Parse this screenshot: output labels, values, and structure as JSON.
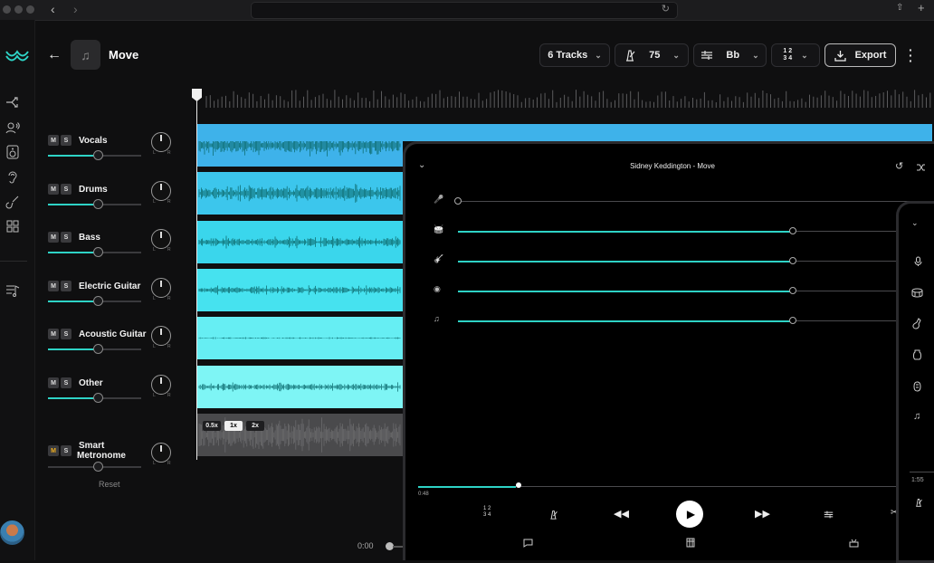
{
  "header": {
    "title": "Move",
    "tracks_button": "6 Tracks",
    "tempo": "75",
    "key": "Bb",
    "time_signature_top": "1 2",
    "time_signature_bottom": "3 4",
    "export_label": "Export"
  },
  "tracks": [
    {
      "name": "Vocals",
      "volume": 0.78,
      "color": "#3eb2ea"
    },
    {
      "name": "Drums",
      "volume": 0.78,
      "color": "#3cc6ec"
    },
    {
      "name": "Bass",
      "volume": 0.78,
      "color": "#3ad6ec"
    },
    {
      "name": "Electric Guitar",
      "volume": 0.78,
      "color": "#46e2ef"
    },
    {
      "name": "Acoustic Guitar",
      "volume": 0.78,
      "color": "#66eef3"
    },
    {
      "name": "Other",
      "volume": 0.78,
      "color": "#7ef5f5"
    },
    {
      "name": "Smart",
      "name2": "Metronome",
      "volume": 0.78,
      "color": "#4a4a4c"
    }
  ],
  "ms": {
    "mute": "M",
    "solo": "S"
  },
  "knob_labels": {
    "left": "L",
    "right": "R"
  },
  "metronome_speeds": [
    "0.5x",
    "1x",
    "2x"
  ],
  "reset_label": "Reset",
  "transport": {
    "time": "0:00"
  },
  "player": {
    "title": "Sidney Keddington - Move",
    "elapsed": "0:48",
    "progress": 0.19,
    "time_sig_top": "1 2",
    "time_sig_bottom": "3 4",
    "stems": [
      {
        "icon": "mic-muted-icon",
        "level": 0.0
      },
      {
        "icon": "drum-icon",
        "level": 0.77
      },
      {
        "icon": "guitar-icon",
        "level": 0.77
      },
      {
        "icon": "bass-icon",
        "level": 0.77
      },
      {
        "icon": "music-note-icon",
        "level": 0.77
      }
    ]
  },
  "phone": {
    "time": "1:55"
  },
  "colors": {
    "accent": "#2ed3c6",
    "background": "#0f0f10"
  }
}
